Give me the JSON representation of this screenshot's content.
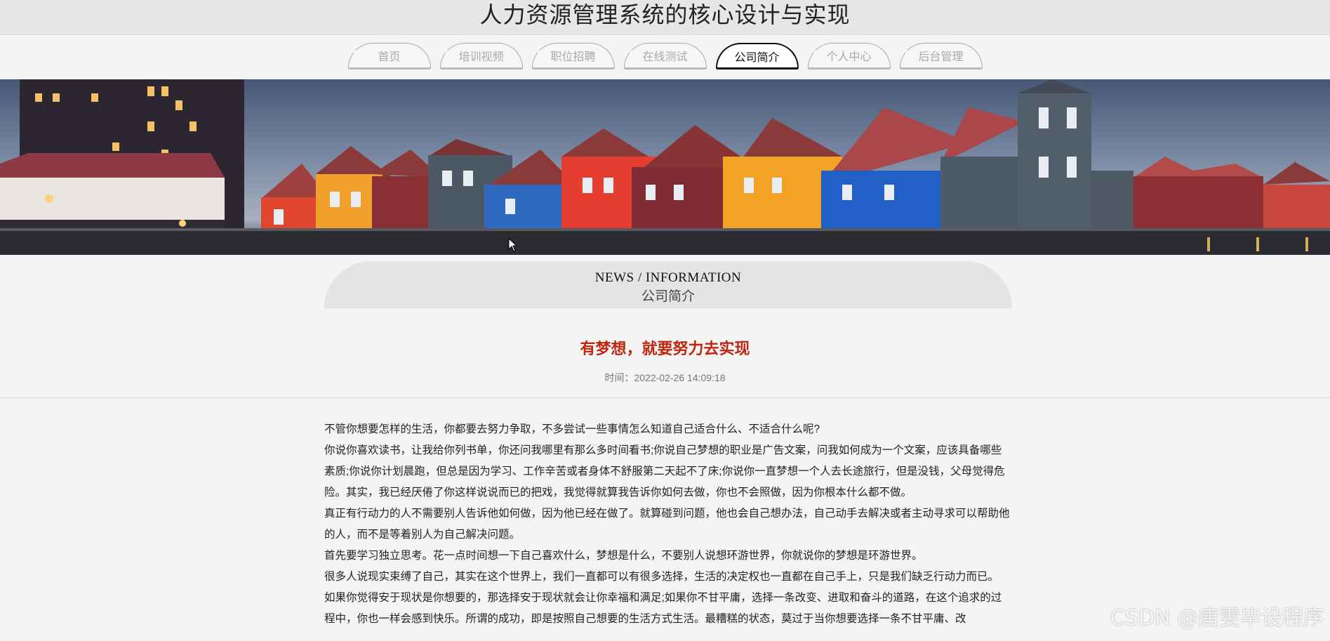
{
  "header": {
    "title": "人力资源管理系统的核心设计与实现"
  },
  "nav": {
    "items": [
      {
        "label": "首页",
        "active": false
      },
      {
        "label": "培训视频",
        "active": false
      },
      {
        "label": "职位招聘",
        "active": false
      },
      {
        "label": "在线测试",
        "active": false
      },
      {
        "label": "公司简介",
        "active": true
      },
      {
        "label": "个人中心",
        "active": false
      },
      {
        "label": "后台管理",
        "active": false
      }
    ]
  },
  "section": {
    "title_en": "NEWS / INFORMATION",
    "title_cn": "公司简介"
  },
  "article": {
    "title": "有梦想，就要努力去实现",
    "time": "时间：2022-02-26 14:09:18",
    "paragraphs": [
      "不管你想要怎样的生活，你都要去努力争取，不多尝试一些事情怎么知道自己适合什么、不适合什么呢?",
      "你说你喜欢读书，让我给你列书单，你还问我哪里有那么多时间看书;你说自己梦想的职业是广告文案，问我如何成为一个文案，应该具备哪些素质;你说你计划晨跑，但总是因为学习、工作辛苦或者身体不舒服第二天起不了床;你说你一直梦想一个人去长途旅行，但是没钱，父母觉得危险。其实，我已经厌倦了你这样说说而已的把戏，我觉得就算我告诉你如何去做，你也不会照做，因为你根本什么都不做。",
      "真正有行动力的人不需要别人告诉他如何做，因为他已经在做了。就算碰到问题，他也会自己想办法，自己动手去解决或者主动寻求可以帮助他的人，而不是等着别人为自己解决问题。",
      "首先要学习独立思考。花一点时间想一下自己喜欢什么，梦想是什么，不要别人说想环游世界，你就说你的梦想是环游世界。",
      "很多人说现实束缚了自己，其实在这个世界上，我们一直都可以有很多选择，生活的决定权也一直都在自己手上，只是我们缺乏行动力而已。",
      "如果你觉得安于现状是你想要的，那选择安于现状就会让你幸福和满足;如果你不甘平庸，选择一条改变、进取和奋斗的道路，在这个追求的过程中，你也一样会感到快乐。所谓的成功，即是按照自己想要的生活方式生活。最糟糕的状态，莫过于当你想要选择一条不甘平庸、改"
    ]
  },
  "watermark": "CSDN @唐雯毕设程序"
}
